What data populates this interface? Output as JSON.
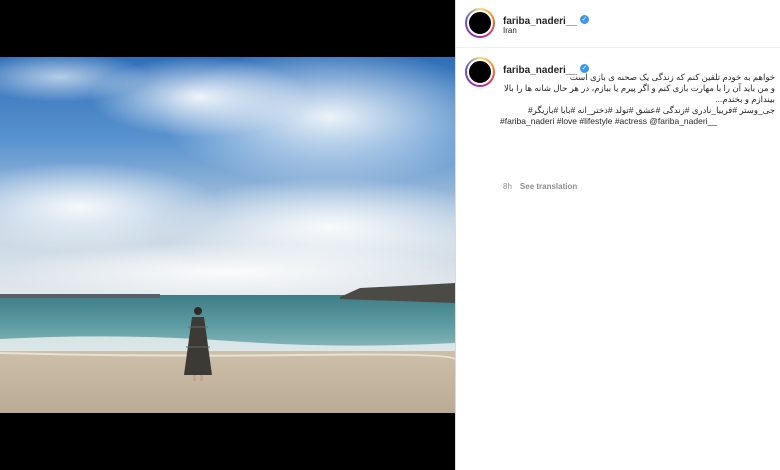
{
  "post": {
    "author": {
      "username": "fariba_naderi__",
      "location": "Iran"
    },
    "caption": {
      "username": "fariba_naderi__",
      "lines": [
        "خواهم به خودم تلقین کنم که زندگی یک صحنه ی بازی است",
        "و من باید آن را با مهارت بازی کنم و اگر پیرم یا ببازم، در هر حال شانه ها را بالا",
        "بیندازم و بخندم..."
      ],
      "hashtags_fa": "جی_وستر #فریبا_نادری #زندگی #عشق #تولد #دختر_انه #بابا #بازیگر#",
      "hashtags_en": "#fariba_naderi #love #lifestyle #actress @fariba_naderi__",
      "time_ago": "8h",
      "see_translation": "See translation"
    },
    "photo": {
      "description": ""
    }
  },
  "colors": {
    "verified": "#3897f0",
    "meta": "#8e8e8e",
    "text": "#262626"
  }
}
